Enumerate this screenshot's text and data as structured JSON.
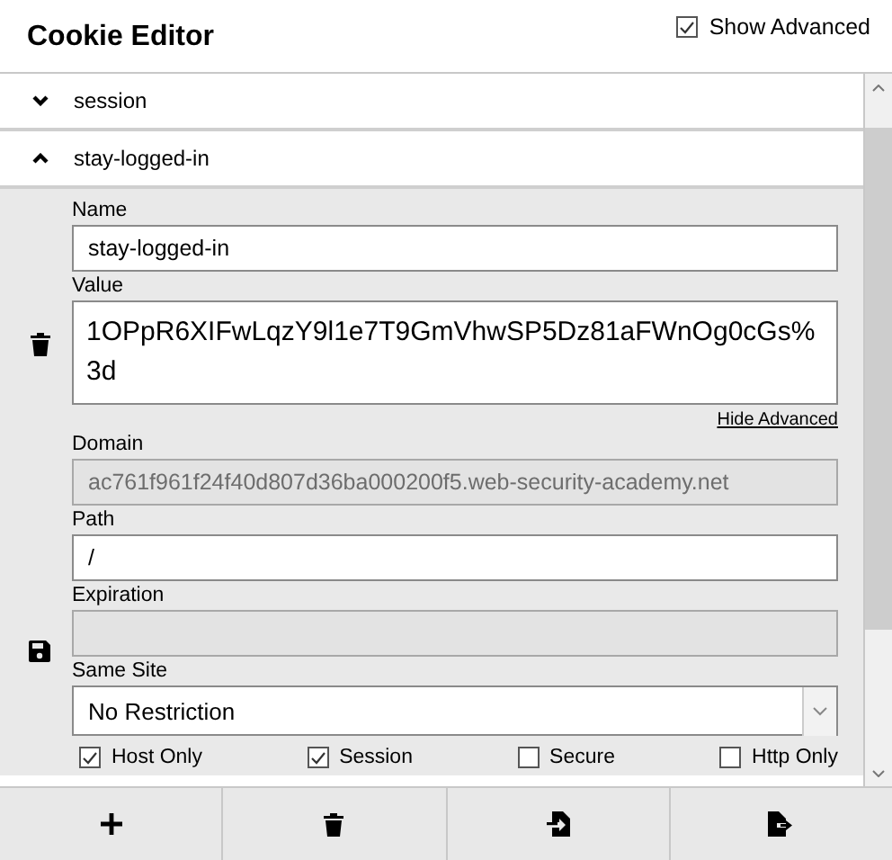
{
  "header": {
    "title": "Cookie Editor",
    "show_advanced": {
      "label": "Show Advanced",
      "checked": true
    }
  },
  "cookies": [
    {
      "name": "session",
      "expanded": false
    },
    {
      "name": "stay-logged-in",
      "expanded": true,
      "details": {
        "fields": [
          {
            "kind": "input",
            "label": "Name",
            "value": "stay-logged-in",
            "disabled": false
          },
          {
            "kind": "textarea",
            "label": "Value",
            "value": "1OPpR6XIFwLqzY9l1e7T9GmVhwSP5Dz81aFWnOg0cGs%3d",
            "disabled": false
          },
          {
            "kind": "link",
            "label": "Hide Advanced"
          },
          {
            "kind": "input",
            "label": "Domain",
            "value": "ac761f961f24f40d807d36ba000200f5.web-security-academy.net",
            "disabled": true
          },
          {
            "kind": "input",
            "label": "Path",
            "value": "/",
            "disabled": false
          },
          {
            "kind": "input",
            "label": "Expiration",
            "disabled": true
          },
          {
            "kind": "select",
            "label": "Same Site",
            "value": "No Restriction",
            "disabled": false
          }
        ],
        "flags": [
          {
            "label": "Host Only",
            "checked": true
          },
          {
            "label": "Session",
            "checked": true
          },
          {
            "label": "Secure",
            "checked": false
          },
          {
            "label": "Http Only",
            "checked": false
          }
        ]
      }
    }
  ],
  "footer": [
    {
      "kind": "add"
    },
    {
      "kind": "delete"
    },
    {
      "kind": "import"
    },
    {
      "kind": "export"
    }
  ]
}
